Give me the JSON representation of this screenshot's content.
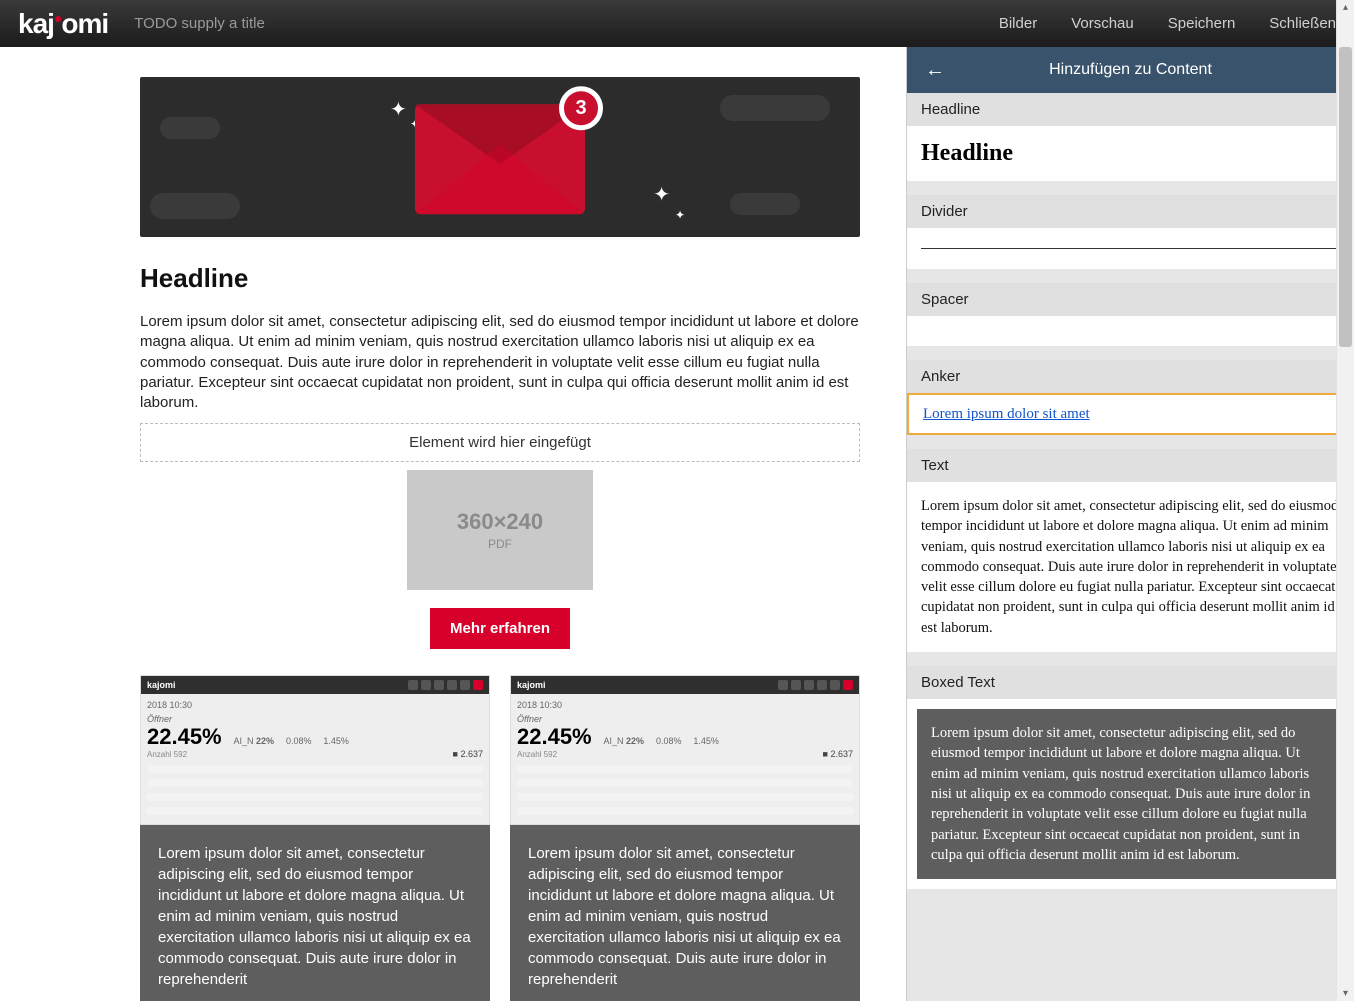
{
  "topbar": {
    "logo_text": "kajomi",
    "title_placeholder": "TODO supply a title",
    "links": {
      "bilder": "Bilder",
      "vorschau": "Vorschau",
      "speichern": "Speichern",
      "schliessen": "Schließen"
    }
  },
  "hero": {
    "badge_count": "3"
  },
  "content": {
    "headline": "Headline",
    "paragraph": "Lorem ipsum dolor sit amet, consectetur adipiscing elit, sed do eiusmod tempor incididunt ut labore et dolore magna aliqua. Ut enim ad minim veniam, quis nostrud exercitation ullamco laboris nisi ut aliquip ex ea commodo consequat. Duis aute irure dolor in reprehenderit in voluptate velit esse cillum eu fugiat nulla pariatur. Excepteur sint occaecat cupidatat non proident, sunt in culpa qui officia deserunt mollit anim id est laborum.",
    "dropzone_text": "Element wird hier eingefügt",
    "placeholder": {
      "dims": "360×240",
      "sub": "PDF"
    },
    "cta_label": "Mehr erfahren",
    "card_dashboard": {
      "logo": "kajomi",
      "timestamp": "2018 10:30",
      "label_offner": "Öffner",
      "big": "22.45%",
      "sub": "Anzahl 592",
      "m1_label": "AI_N",
      "m1": "22%",
      "m2": "0.08%",
      "m3": "1.45%",
      "total": "2.637"
    },
    "card_text": "Lorem ipsum dolor sit amet, consectetur adipiscing elit, sed do eiusmod tempor incididunt ut labore et dolore magna aliqua. Ut enim ad minim veniam, quis nostrud exercitation ullamco laboris nisi ut aliquip ex ea commodo consequat. Duis aute irure dolor in reprehenderit"
  },
  "panel": {
    "title": "Hinzufügen zu Content",
    "blocks": {
      "headline": {
        "label": "Headline",
        "preview": "Headline"
      },
      "divider": {
        "label": "Divider"
      },
      "spacer": {
        "label": "Spacer"
      },
      "anker": {
        "label": "Anker",
        "link_text": "Lorem ipsum dolor sit amet"
      },
      "text": {
        "label": "Text",
        "preview": "Lorem ipsum dolor sit amet, consectetur adipiscing elit, sed do eiusmod tempor incididunt ut labore et dolore magna aliqua. Ut enim ad minim veniam, quis nostrud exercitation ullamco laboris nisi ut aliquip ex ea commodo consequat. Duis aute irure dolor in reprehenderit in voluptate velit esse cillum dolore eu fugiat nulla pariatur. Excepteur sint occaecat cupidatat non proident, sunt in culpa qui officia deserunt mollit anim id est laborum."
      },
      "boxed": {
        "label": "Boxed Text",
        "preview": "Lorem ipsum dolor sit amet, consectetur adipiscing elit, sed do eiusmod tempor incididunt ut labore et dolore magna aliqua. Ut enim ad minim veniam, quis nostrud exercitation ullamco laboris nisi ut aliquip ex ea commodo consequat. Duis aute irure dolor in reprehenderit in voluptate velit esse cillum dolore eu fugiat nulla pariatur. Excepteur sint occaecat cupidatat non proident, sunt in culpa qui officia deserunt mollit anim id est laborum."
      }
    }
  }
}
